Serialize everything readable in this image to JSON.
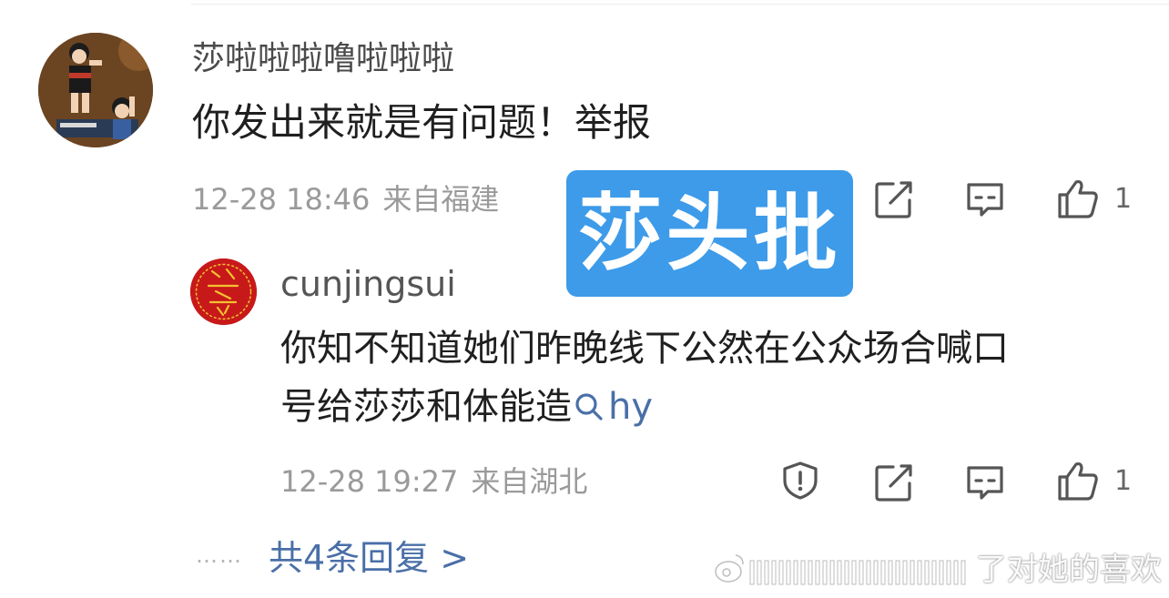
{
  "comment": {
    "username": "莎啦啦啦噜啦啦啦",
    "text": "你发出来就是有问题！举报",
    "date": "12-28 18:46",
    "location": "来自福建",
    "like_count": "1"
  },
  "sticker": {
    "text": "莎头批"
  },
  "reply": {
    "username": "cunjingsui",
    "text_line1": "你知不知道她们昨晚线下公然在公众场合喊口",
    "text_line2": "号给莎莎和体能造",
    "search_link": "hy",
    "date": "12-28 19:27",
    "location": "来自湖北",
    "like_count": "1"
  },
  "more_replies": {
    "dots": "……",
    "label": "共4条回复 >"
  },
  "watermark": {
    "text": "了对她的喜欢"
  },
  "colors": {
    "link": "#4a6fa8",
    "sticker_bg": "#3d9be9",
    "meta": "#9a9a9a"
  },
  "icons": [
    "report-icon",
    "share-icon",
    "comment-icon",
    "like-icon",
    "search-icon",
    "weibo-logo-icon"
  ]
}
